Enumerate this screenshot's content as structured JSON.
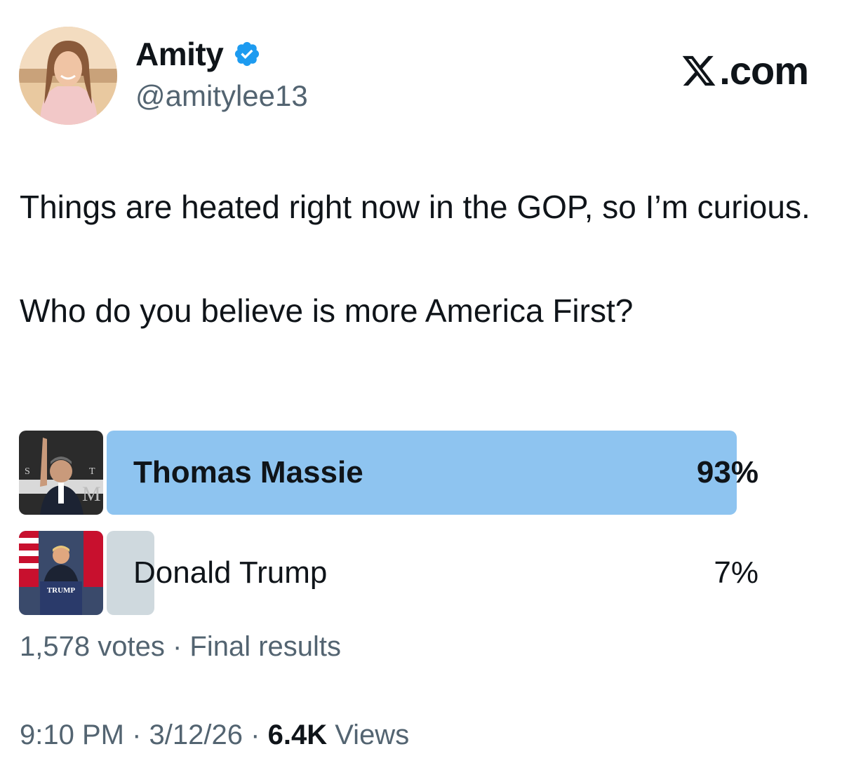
{
  "header": {
    "display_name": "Amity",
    "handle": "@amitylee13",
    "brand": ".com",
    "verified_icon": "verified-badge-icon",
    "verified_color": "#1d9bf0"
  },
  "tweet": {
    "line1": "Things are heated right now in the GOP, so I’m curious.",
    "line2": "Who do you believe is more America First?"
  },
  "poll": {
    "options": [
      {
        "label": "Thomas Massie",
        "percent_text": "93%",
        "percent": 93,
        "winner": true
      },
      {
        "label": "Donald Trump",
        "percent_text": "7%",
        "percent": 7,
        "winner": false
      }
    ],
    "votes": "1,578 votes",
    "separator": "·",
    "status": "Final results",
    "winner_color": "#8ec4f0",
    "loser_color": "#cfd9de"
  },
  "footer": {
    "time": "9:10 PM",
    "date": "3/12/26",
    "views_count": "6.4K",
    "views_label": "Views",
    "separator": "·"
  }
}
